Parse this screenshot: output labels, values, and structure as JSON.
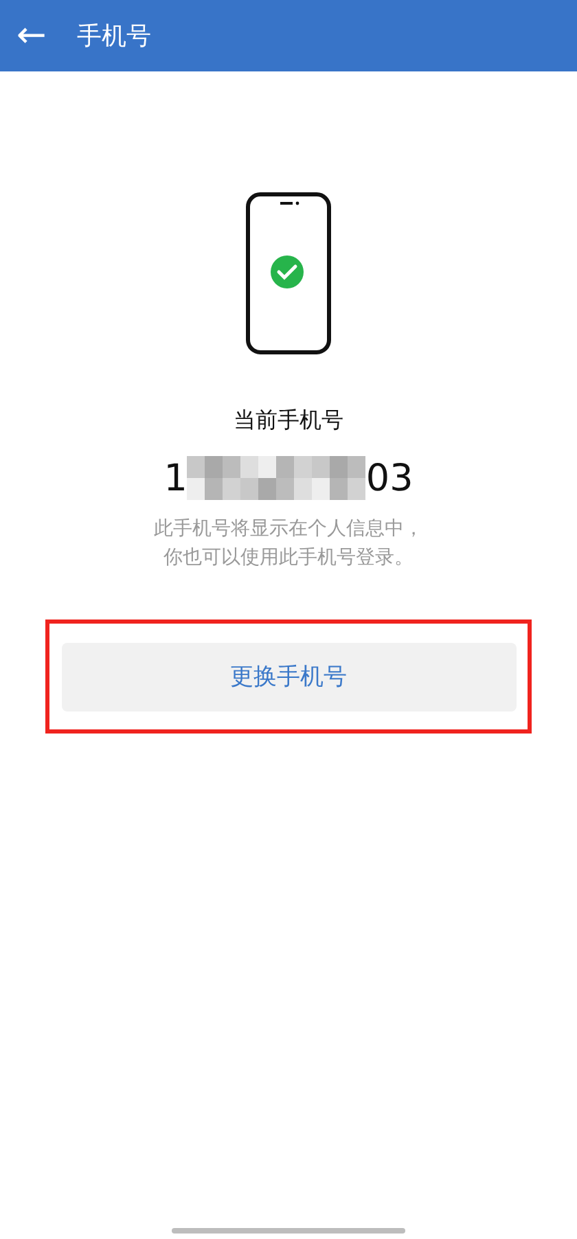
{
  "header": {
    "back_icon": "←",
    "title": "手机号"
  },
  "current_label": "当前手机号",
  "phone_number": {
    "start": "1",
    "end": "03",
    "redacted": true
  },
  "description_lines": [
    "此手机号将显示在个人信息中，",
    "你也可以使用此手机号登录。"
  ],
  "change_button": {
    "label": "更换手机号",
    "highlighted": true
  }
}
